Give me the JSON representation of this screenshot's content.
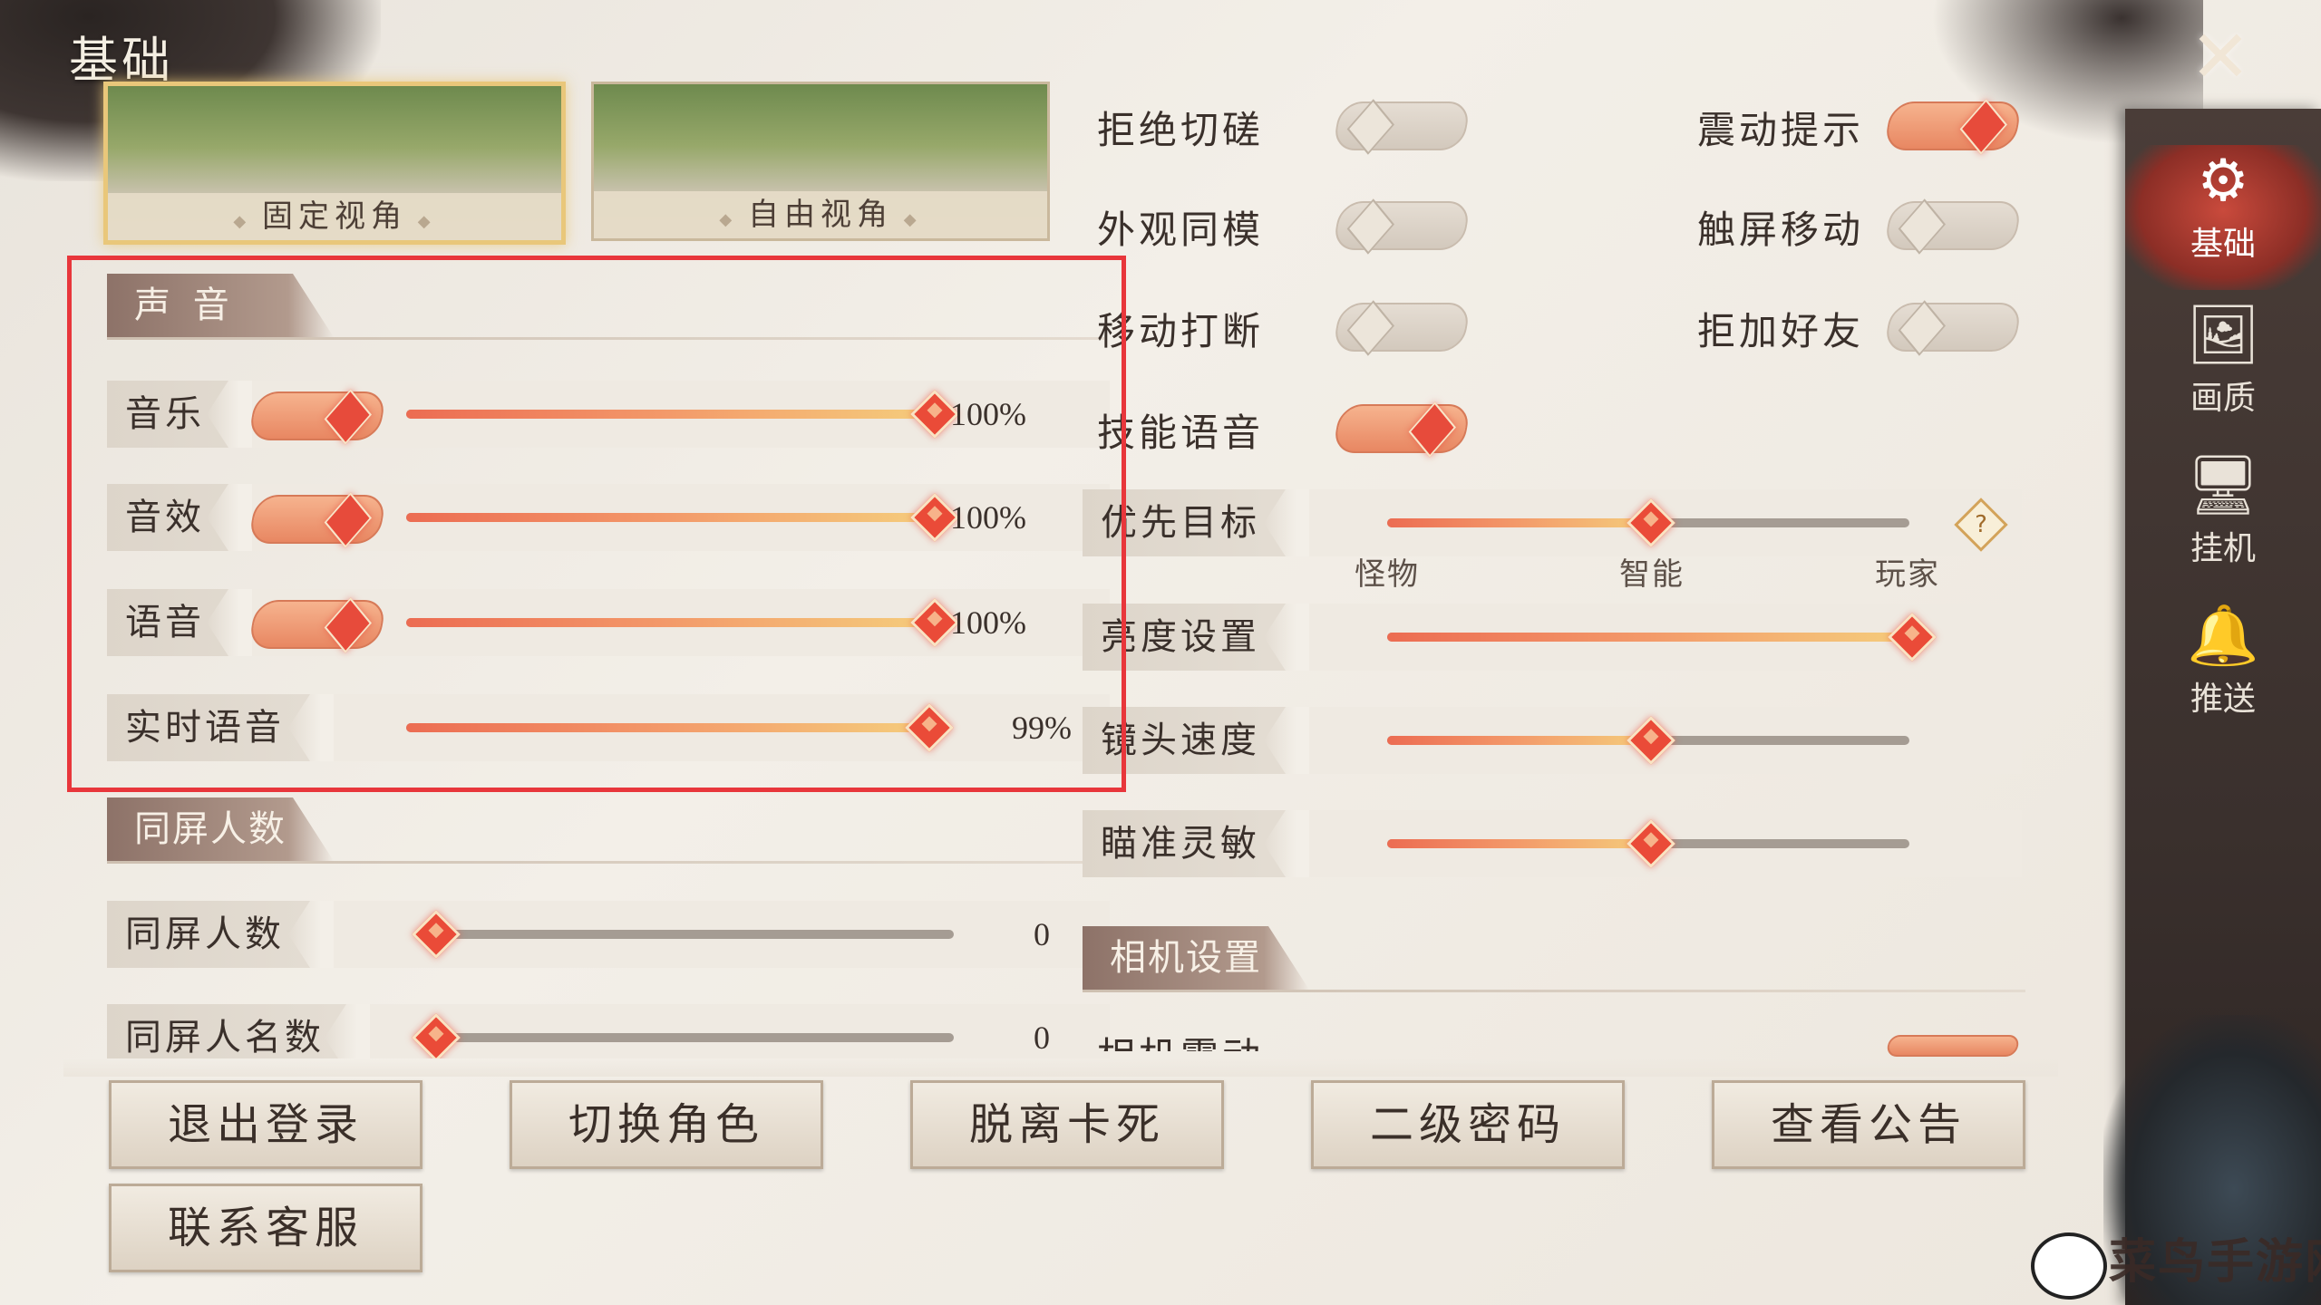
{
  "title": "基础",
  "close_icon": "close-x-icon",
  "sidebar": {
    "items": [
      {
        "label": "基础",
        "icon": "gear-icon",
        "glyph": "⚙",
        "active": true
      },
      {
        "label": "画质",
        "icon": "image-icon",
        "glyph": "🖼",
        "active": false
      },
      {
        "label": "挂机",
        "icon": "monitor-icon",
        "glyph": "🖥",
        "active": false
      },
      {
        "label": "推送",
        "icon": "bell-icon",
        "glyph": "🔔",
        "active": false
      }
    ]
  },
  "views": [
    {
      "label": "固定视角",
      "selected": true
    },
    {
      "label": "自由视角",
      "selected": false
    }
  ],
  "sound": {
    "header": "声 音",
    "rows": [
      {
        "label": "音乐",
        "enabled": true,
        "value": 100,
        "value_text": "100%"
      },
      {
        "label": "音效",
        "enabled": true,
        "value": 100,
        "value_text": "100%"
      },
      {
        "label": "语音",
        "enabled": true,
        "value": 100,
        "value_text": "100%"
      },
      {
        "label": "实时语音",
        "value": 99,
        "value_text": "99%"
      }
    ]
  },
  "same_screen": {
    "header": "同屏人数",
    "rows": [
      {
        "label": "同屏人数",
        "value": 0,
        "value_text": "0"
      },
      {
        "label": "同屏人名数",
        "value": 0,
        "value_text": "0"
      }
    ]
  },
  "toggles": [
    {
      "label": "拒绝切磋",
      "on": false
    },
    {
      "label": "震动提示",
      "on": true
    },
    {
      "label": "外观同模",
      "on": false
    },
    {
      "label": "触屏移动",
      "on": false
    },
    {
      "label": "移动打断",
      "on": false
    },
    {
      "label": "拒加好友",
      "on": false
    },
    {
      "label": "技能语音",
      "on": true
    }
  ],
  "priority_target": {
    "label": "优先目标",
    "options": [
      "怪物",
      "智能",
      "玩家"
    ],
    "selected": "智能",
    "help_icon": "question-icon",
    "help_text": "?"
  },
  "right_sliders": [
    {
      "label": "亮度设置",
      "value": 1.0
    },
    {
      "label": "镜头速度",
      "value": 0.5
    },
    {
      "label": "瞄准灵敏",
      "value": 0.5
    }
  ],
  "camera": {
    "header": "相机设置",
    "partial_row": "相机震动"
  },
  "buttons": [
    {
      "label": "退出登录"
    },
    {
      "label": "切换角色"
    },
    {
      "label": "脱离卡死"
    },
    {
      "label": "二级密码"
    },
    {
      "label": "查看公告"
    },
    {
      "label": "联系客服"
    }
  ],
  "watermark": "菜鸟手游网",
  "colors": {
    "accent": "#e74b3b",
    "highlight_box": "#e8363b",
    "toggle_on": "#e88762"
  }
}
